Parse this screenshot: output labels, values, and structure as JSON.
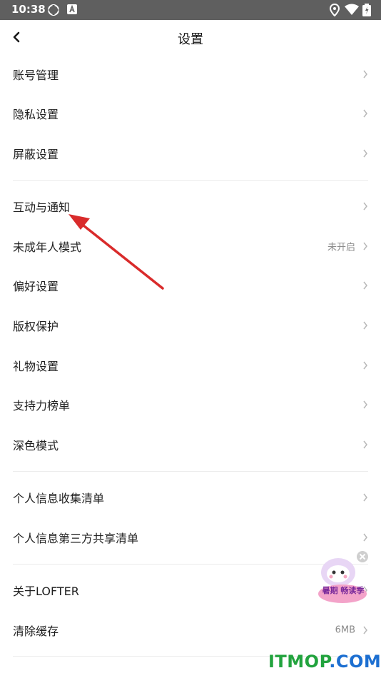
{
  "status_bar": {
    "time": "10:38"
  },
  "header": {
    "title": "设置"
  },
  "groups": [
    {
      "items": [
        {
          "label": "账号管理"
        },
        {
          "label": "隐私设置"
        },
        {
          "label": "屏蔽设置"
        }
      ]
    },
    {
      "items": [
        {
          "label": "互动与通知"
        },
        {
          "label": "未成年人模式",
          "value": "未开启"
        },
        {
          "label": "偏好设置"
        },
        {
          "label": "版权保护"
        },
        {
          "label": "礼物设置"
        },
        {
          "label": "支持力榜单"
        },
        {
          "label": "深色模式"
        }
      ]
    },
    {
      "items": [
        {
          "label": "个人信息收集清单"
        },
        {
          "label": "个人信息第三方共享清单"
        }
      ]
    },
    {
      "items": [
        {
          "label": "关于LOFTER"
        },
        {
          "label": "清除缓存",
          "value": "6MB"
        }
      ]
    }
  ],
  "promo_badge": {
    "text": "暑期 畅读季"
  },
  "watermark": {
    "part1": "ITMOP",
    "part2": ".COM"
  },
  "colors": {
    "status_bar": "#5f5f5f",
    "arrow": "#d92b2b",
    "divider": "#ececec",
    "watermark_green": "#22a33e",
    "watermark_blue": "#1c6fd1"
  }
}
